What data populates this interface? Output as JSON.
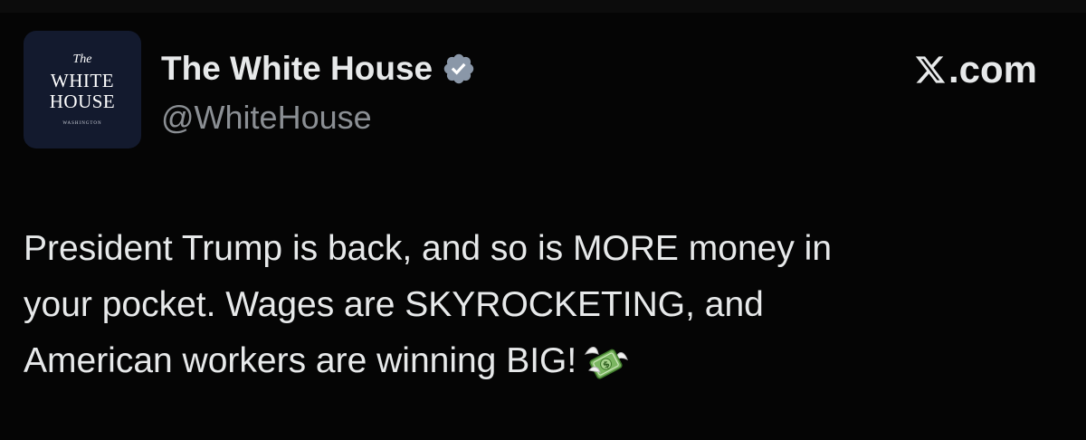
{
  "avatar": {
    "line_the": "The",
    "line_white": "WHITE",
    "line_house": "HOUSE",
    "line_sub": "WASHINGTON"
  },
  "header": {
    "display_name": "The White House",
    "handle": "@WhiteHouse",
    "verified_icon": "verified-badge-icon",
    "verified_color": "#8a97a8",
    "brand_text": ".com",
    "brand_logo": "x-logo-icon"
  },
  "tweet": {
    "line1": "President Trump is back, and so is MORE money in",
    "line2": "your pocket. Wages are SKYROCKETING, and",
    "line3": "American workers are winning BIG!",
    "emoji": "money-with-wings-icon"
  },
  "colors": {
    "background": "#050505",
    "text": "#e7e9ea",
    "secondary_text": "#8b8f94",
    "avatar_bg": "#131a2e"
  }
}
